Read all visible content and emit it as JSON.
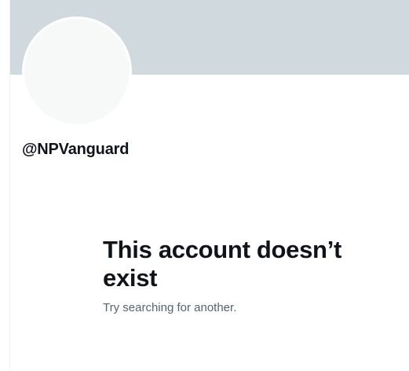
{
  "profile": {
    "handle": "@NPVanguard"
  },
  "empty_state": {
    "title": "This account doesn’t exist",
    "subtitle": "Try searching for another."
  },
  "colors": {
    "banner": "#cfd9de",
    "avatar": "#f7f9f9",
    "text_primary": "#0f1419",
    "text_secondary": "#536471"
  }
}
